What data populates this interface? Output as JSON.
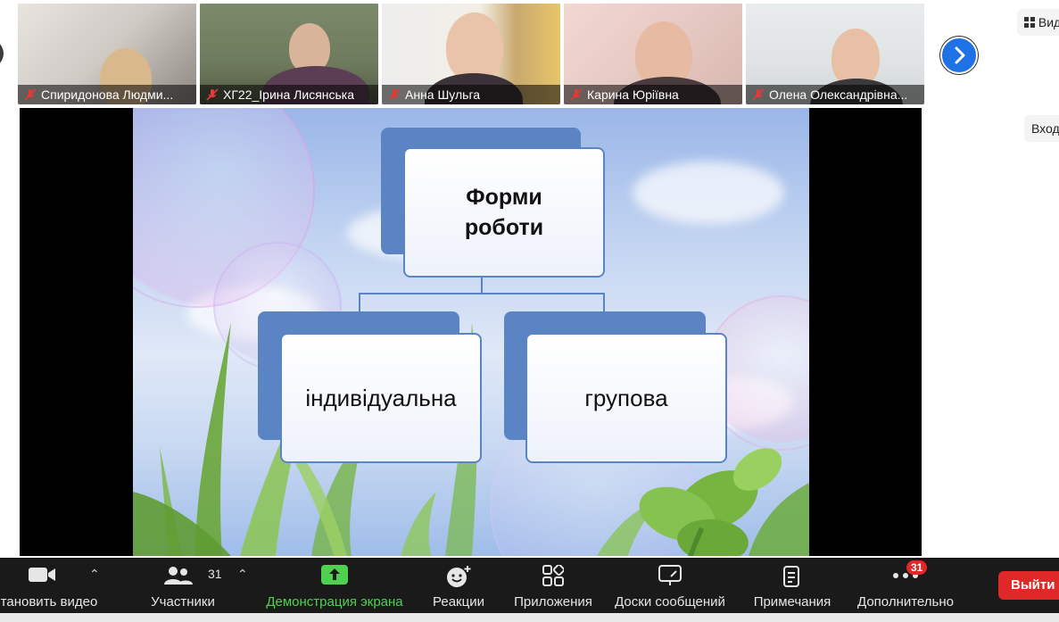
{
  "participants_strip": {
    "tiles": [
      {
        "name": "Спиридонова Людми..."
      },
      {
        "name": "ХГ22_Ірина Лисянська"
      },
      {
        "name": "Анна Шульга"
      },
      {
        "name": "Карина Юріївна"
      },
      {
        "name": "Олена Олександрівна..."
      }
    ]
  },
  "right_panel": {
    "view_label": "Вид",
    "input_label": "Вход"
  },
  "slide": {
    "top_box": "Форми роботи",
    "left_box": "індивідуальна",
    "right_box": "групова"
  },
  "toolbar": {
    "video_label": "тановить видео",
    "participants_label": "Участники",
    "participants_count": "31",
    "share_label": "Демонстрация экрана",
    "reactions_label": "Реакции",
    "apps_label": "Приложения",
    "whiteboards_label": "Доски сообщений",
    "notes_label": "Примечания",
    "more_label": "Дополнительно",
    "more_badge": "31",
    "exit_label": "Выйти"
  },
  "colors": {
    "share_accent": "#4fd14f",
    "exit": "#e02828",
    "next_button": "#1f72e6",
    "diagram_box": "#5b84c4"
  }
}
